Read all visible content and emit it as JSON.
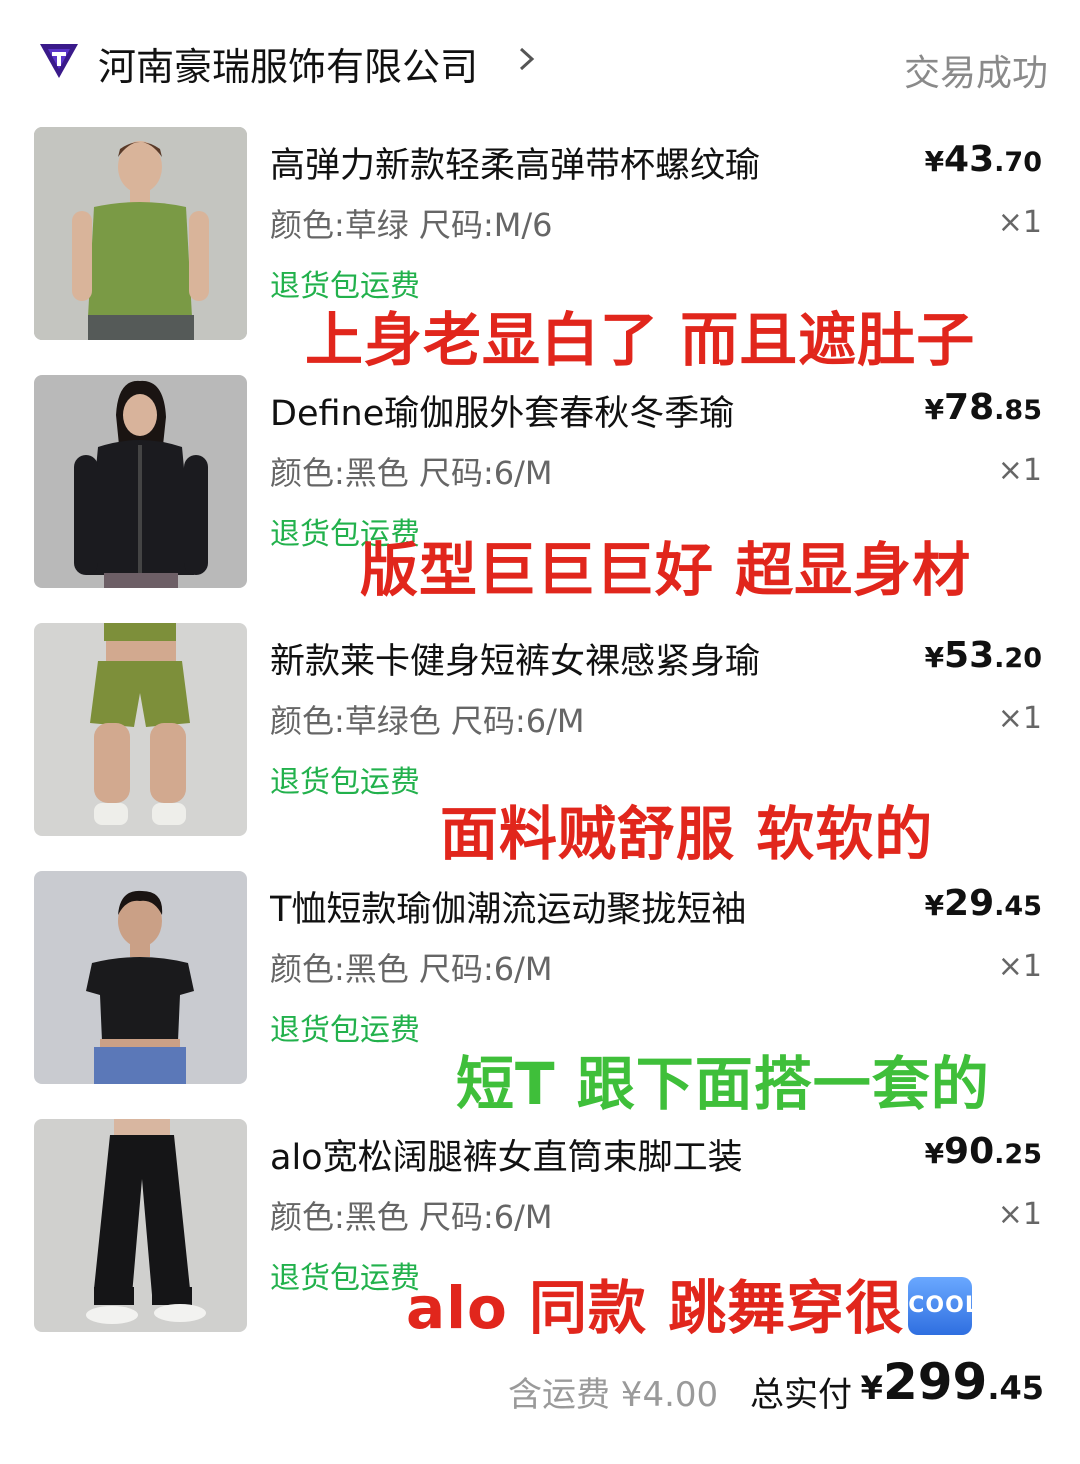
{
  "store": {
    "name": "河南豪瑞服饰有限公司",
    "status": "交易成功"
  },
  "items": [
    {
      "title": "高弹力新款轻柔高弹带杯螺纹瑜",
      "price_currency": "¥",
      "price_int": "43",
      "price_dec": ".70",
      "spec": "颜色:草绿 尺码:M/6",
      "qty": "×1",
      "refund": "退货包运费",
      "comment": "上身老显白了 而且遮肚子",
      "comment_color": "#e1261c",
      "thumb_color": "#7a9a45"
    },
    {
      "title": "Define瑜伽服外套春秋冬季瑜",
      "price_currency": "¥",
      "price_int": "78",
      "price_dec": ".85",
      "spec": "颜色:黑色 尺码:6/M",
      "qty": "×1",
      "refund": "退货包运费",
      "comment": "版型巨巨巨好 超显身材",
      "comment_color": "#e1261c",
      "thumb_color": "#1b1b1f"
    },
    {
      "title": "新款莱卡健身短裤女裸感紧身瑜",
      "price_currency": "¥",
      "price_int": "53",
      "price_dec": ".20",
      "spec": "颜色:草绿色 尺码:6/M",
      "qty": "×1",
      "refund": "退货包运费",
      "comment": "面料贼舒服 软软的",
      "comment_color": "#e1261c",
      "thumb_color": "#7d8f3a"
    },
    {
      "title": "T恤短款瑜伽潮流运动聚拢短袖",
      "price_currency": "¥",
      "price_int": "29",
      "price_dec": ".45",
      "spec": "颜色:黑色 尺码:6/M",
      "qty": "×1",
      "refund": "退货包运费",
      "comment": "短T 跟下面搭一套的",
      "comment_color": "#3fbf3a",
      "thumb_color": "#1a1a1c"
    },
    {
      "title": "alo宽松阔腿裤女直筒束脚工装",
      "price_currency": "¥",
      "price_int": "90",
      "price_dec": ".25",
      "spec": "颜色:黑色 尺码:6/M",
      "qty": "×1",
      "refund": "退货包运费",
      "comment": "alo 同款 跳舞穿很",
      "comment_badge": "COOL",
      "comment_color": "#e1261c",
      "thumb_color": "#151517"
    }
  ],
  "footer": {
    "shipping": "含运费 ¥4.00",
    "total_label": "总实付",
    "total_currency": "¥",
    "total_int": "299",
    "total_dec": ".45"
  }
}
